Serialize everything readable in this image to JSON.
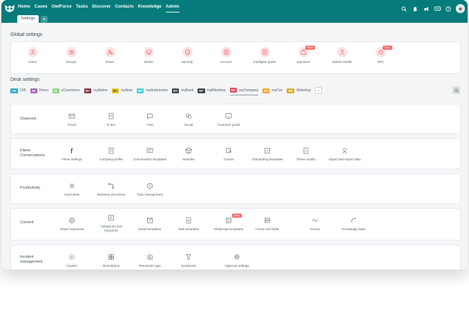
{
  "nav": {
    "items": [
      "Home",
      "Cases",
      "OwlForce",
      "Tasks",
      "Discover",
      "Contacts",
      "Knowledge",
      "Admin"
    ],
    "active": "Admin"
  },
  "tabs": {
    "settings": "Settings",
    "add": "+"
  },
  "global": {
    "title": "Global settings",
    "items": [
      {
        "label": "Users",
        "icon": "users-icon"
      },
      {
        "label": "Groups",
        "icon": "groups-icon"
      },
      {
        "label": "Roles",
        "icon": "roles-icon"
      },
      {
        "label": "Desks",
        "icon": "desks-icon"
      },
      {
        "label": "Security",
        "icon": "security-icon"
      },
      {
        "label": "Account",
        "icon": "account-icon"
      },
      {
        "label": "Intelligent guide",
        "icon": "guide-icon"
      },
      {
        "label": "App store",
        "icon": "app-store-icon",
        "beta": "Beta"
      },
      {
        "label": "System health",
        "icon": "system-health-icon"
      },
      {
        "label": "RPA",
        "icon": "rpa-icon",
        "beta": "Beta"
      }
    ]
  },
  "desk": {
    "title": "Desk settings",
    "brands": [
      {
        "code": "CM",
        "name": "CMI",
        "color": "#2aa1c8"
      },
      {
        "code": "DE",
        "name": "Demo",
        "color": "#a05fb5"
      },
      {
        "code": "EC",
        "name": "eCommerce",
        "color": "#8bd17c"
      },
      {
        "code": "MY",
        "name": "myAirline",
        "color": "#7a2f3a"
      },
      {
        "code": "MY",
        "name": "myAuto",
        "color": "#e6c41e"
      },
      {
        "code": "MY",
        "name": "myAutomotive",
        "color": "#3fd1d1"
      },
      {
        "code": "MY",
        "name": "myBank",
        "color": "#3a3f44"
      },
      {
        "code": "MY",
        "name": "myBikeshop",
        "color": "#3a3f44"
      },
      {
        "code": "MY",
        "name": "myCompany",
        "color": "#e24b5b"
      },
      {
        "code": "MY",
        "name": "myCon",
        "color": "#f0a02c"
      },
      {
        "code": "WE",
        "name": "Webshop",
        "color": "#d9a81e"
      }
    ],
    "active_brand": "myCompany",
    "more": "⌄",
    "sections": [
      {
        "label": "Channels",
        "items": [
          "Email",
          "E-doc",
          "Chat",
          "Social",
          "Customer portal"
        ]
      },
      {
        "label": "Fileee Conversations",
        "items": [
          "Fileee settings",
          "Company profile",
          "Conversation templates",
          "Modules",
          "Actions",
          "Onboarding templates",
          "Fileee emails",
          "Import and export data"
        ]
      },
      {
        "label": "Productivity",
        "items": [
          "Automation",
          "Business processes",
          "Time management"
        ]
      },
      {
        "label": "Content",
        "items": [
          "Smart responses",
          "Categories and keywords",
          "Email templates",
          "Task templates",
          "WhatsApp templates",
          "Forms and fields",
          "Survey",
          "Knowledge base"
        ],
        "beta_item": "WhatsApp templates",
        "beta": "Beta"
      },
      {
        "label": "Incident management",
        "items": [
          "Causes",
          "Resolutions",
          "Resolution type",
          "Symptoms",
          "Approval settings"
        ]
      }
    ]
  },
  "colors": {
    "topbar": "#057b7b",
    "accent": "#f26b6b",
    "icon_pink": "#fde4e4"
  }
}
